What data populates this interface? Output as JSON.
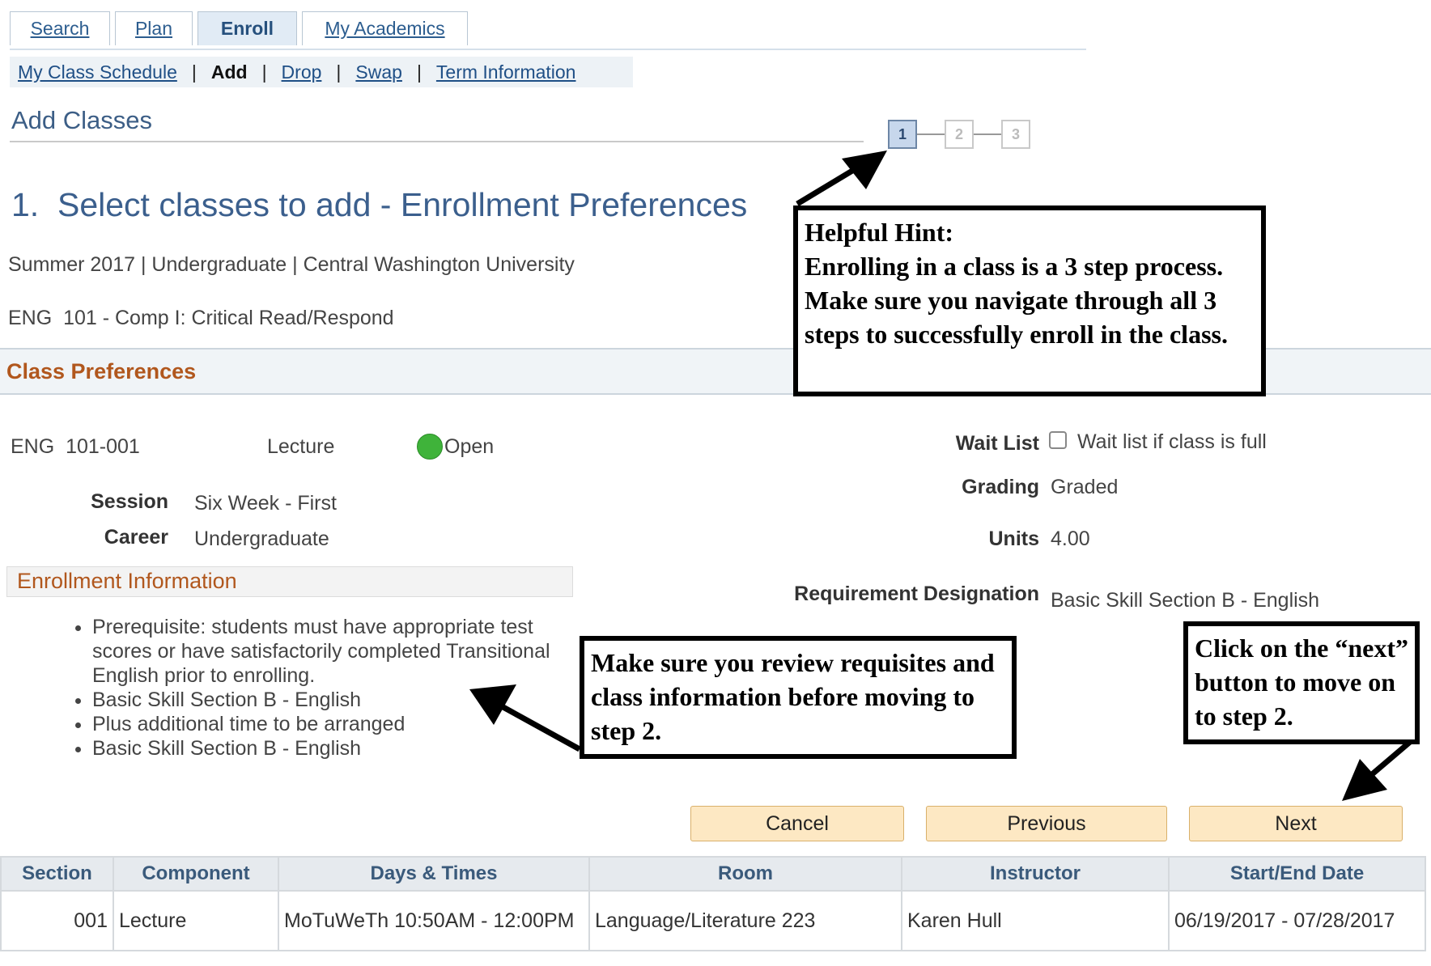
{
  "tabs": [
    {
      "label": "Search",
      "active": false
    },
    {
      "label": "Plan",
      "active": false
    },
    {
      "label": "Enroll",
      "active": true
    },
    {
      "label": "My Academics",
      "active": false
    }
  ],
  "subnav": {
    "my_class_schedule": "My Class Schedule",
    "add": "Add",
    "drop": "Drop",
    "swap": "Swap",
    "term_information": "Term Information",
    "separator": "|"
  },
  "page_title": "Add Classes",
  "steps": [
    "1",
    "2",
    "3"
  ],
  "heading": "1.  Select classes to add - Enrollment Preferences",
  "term_line": "Summer 2017 | Undergraduate | Central Washington University",
  "course_line": "ENG  101 - Comp I: Critical Read/Respond",
  "class_preferences": {
    "title": "Class Preferences",
    "section": "ENG  101-001",
    "component": "Lecture",
    "status": "Open",
    "session_label": "Session",
    "session_value": "Six Week - First",
    "career_label": "Career",
    "career_value": "Undergraduate",
    "wait_list_label": "Wait List",
    "wait_list_text": "Wait list if class is full",
    "grading_label": "Grading",
    "grading_value": "Graded",
    "units_label": "Units",
    "units_value": "4.00",
    "requirement_label": "Requirement Designation",
    "requirement_value": "Basic Skill Section B - English"
  },
  "enrollment_information": {
    "title": "Enrollment Information",
    "items": [
      "Prerequisite: students must have appropriate test scores or have satisfactorily completed Transitional English prior to enrolling.",
      "Basic Skill Section B - English",
      "Plus additional time to be arranged",
      "Basic Skill Section B - English"
    ]
  },
  "buttons": {
    "cancel": "Cancel",
    "previous": "Previous",
    "next": "Next"
  },
  "table": {
    "headers": [
      "Section",
      "Component",
      "Days & Times",
      "Room",
      "Instructor",
      "Start/End Date"
    ],
    "row": {
      "section": "001",
      "component": "Lecture",
      "days_times": "MoTuWeTh 10:50AM - 12:00PM",
      "room": "Language/Literature 223",
      "instructor": "Karen Hull",
      "dates": "06/19/2017 - 07/28/2017"
    }
  },
  "callouts": {
    "hint_title": "Helpful Hint:",
    "hint_body": "Enrolling in a class is a 3 step process. Make sure you navigate through all 3 steps to successfully enroll in the class.",
    "review": "Make sure you review requisites and class information before moving to step 2.",
    "next_hint": "Click on the “next” button to move on to step 2."
  },
  "colors": {
    "link": "#1f4f86",
    "section_orange": "#b1571d",
    "button_fill": "#fde8c3",
    "status_open": "#3fb33a"
  }
}
